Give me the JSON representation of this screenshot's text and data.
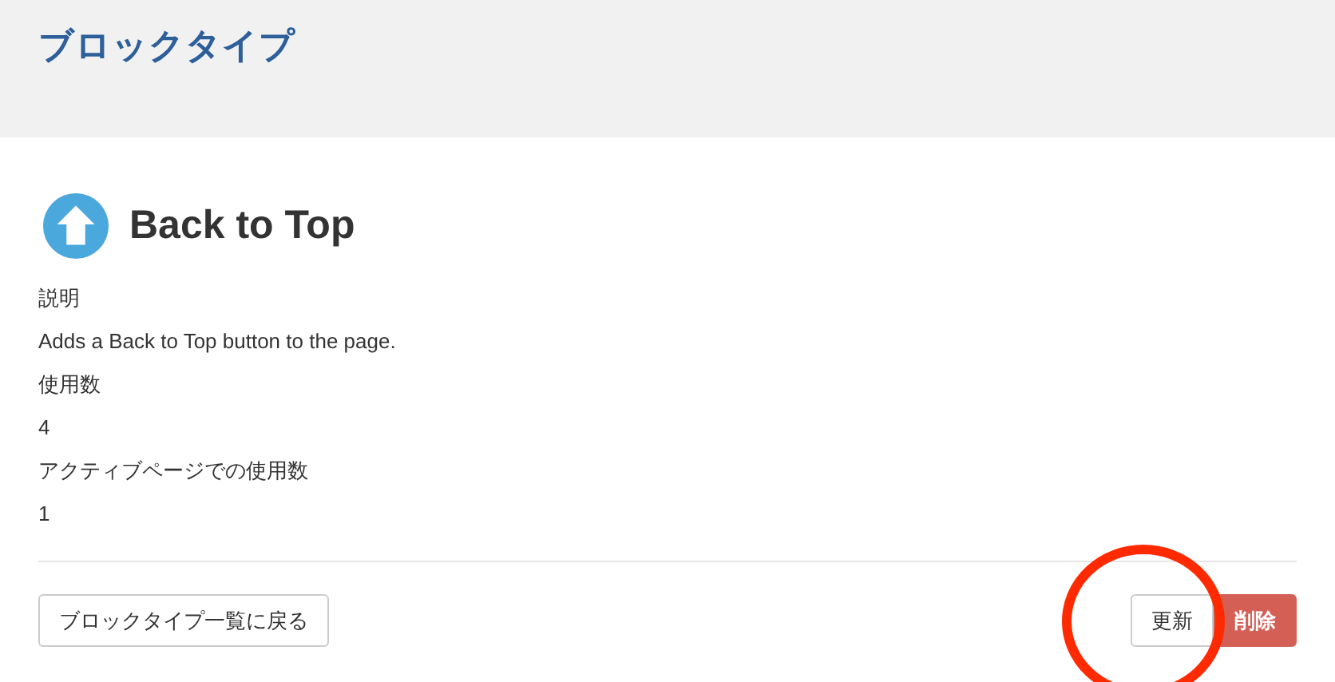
{
  "header": {
    "title": "ブロックタイプ"
  },
  "block": {
    "name": "Back to Top",
    "fields": [
      {
        "label": "説明",
        "value": "Adds a Back to Top button to the page."
      },
      {
        "label": "使用数",
        "value": "4"
      },
      {
        "label": "アクティブページでの使用数",
        "value": "1"
      }
    ]
  },
  "footer": {
    "back_button": "ブロックタイプ一覧に戻る",
    "buttons": [
      {
        "label": "更新",
        "kind": "default"
      },
      {
        "label": "削除",
        "kind": "danger"
      }
    ]
  },
  "annotation": {
    "kind": "ellipse"
  }
}
